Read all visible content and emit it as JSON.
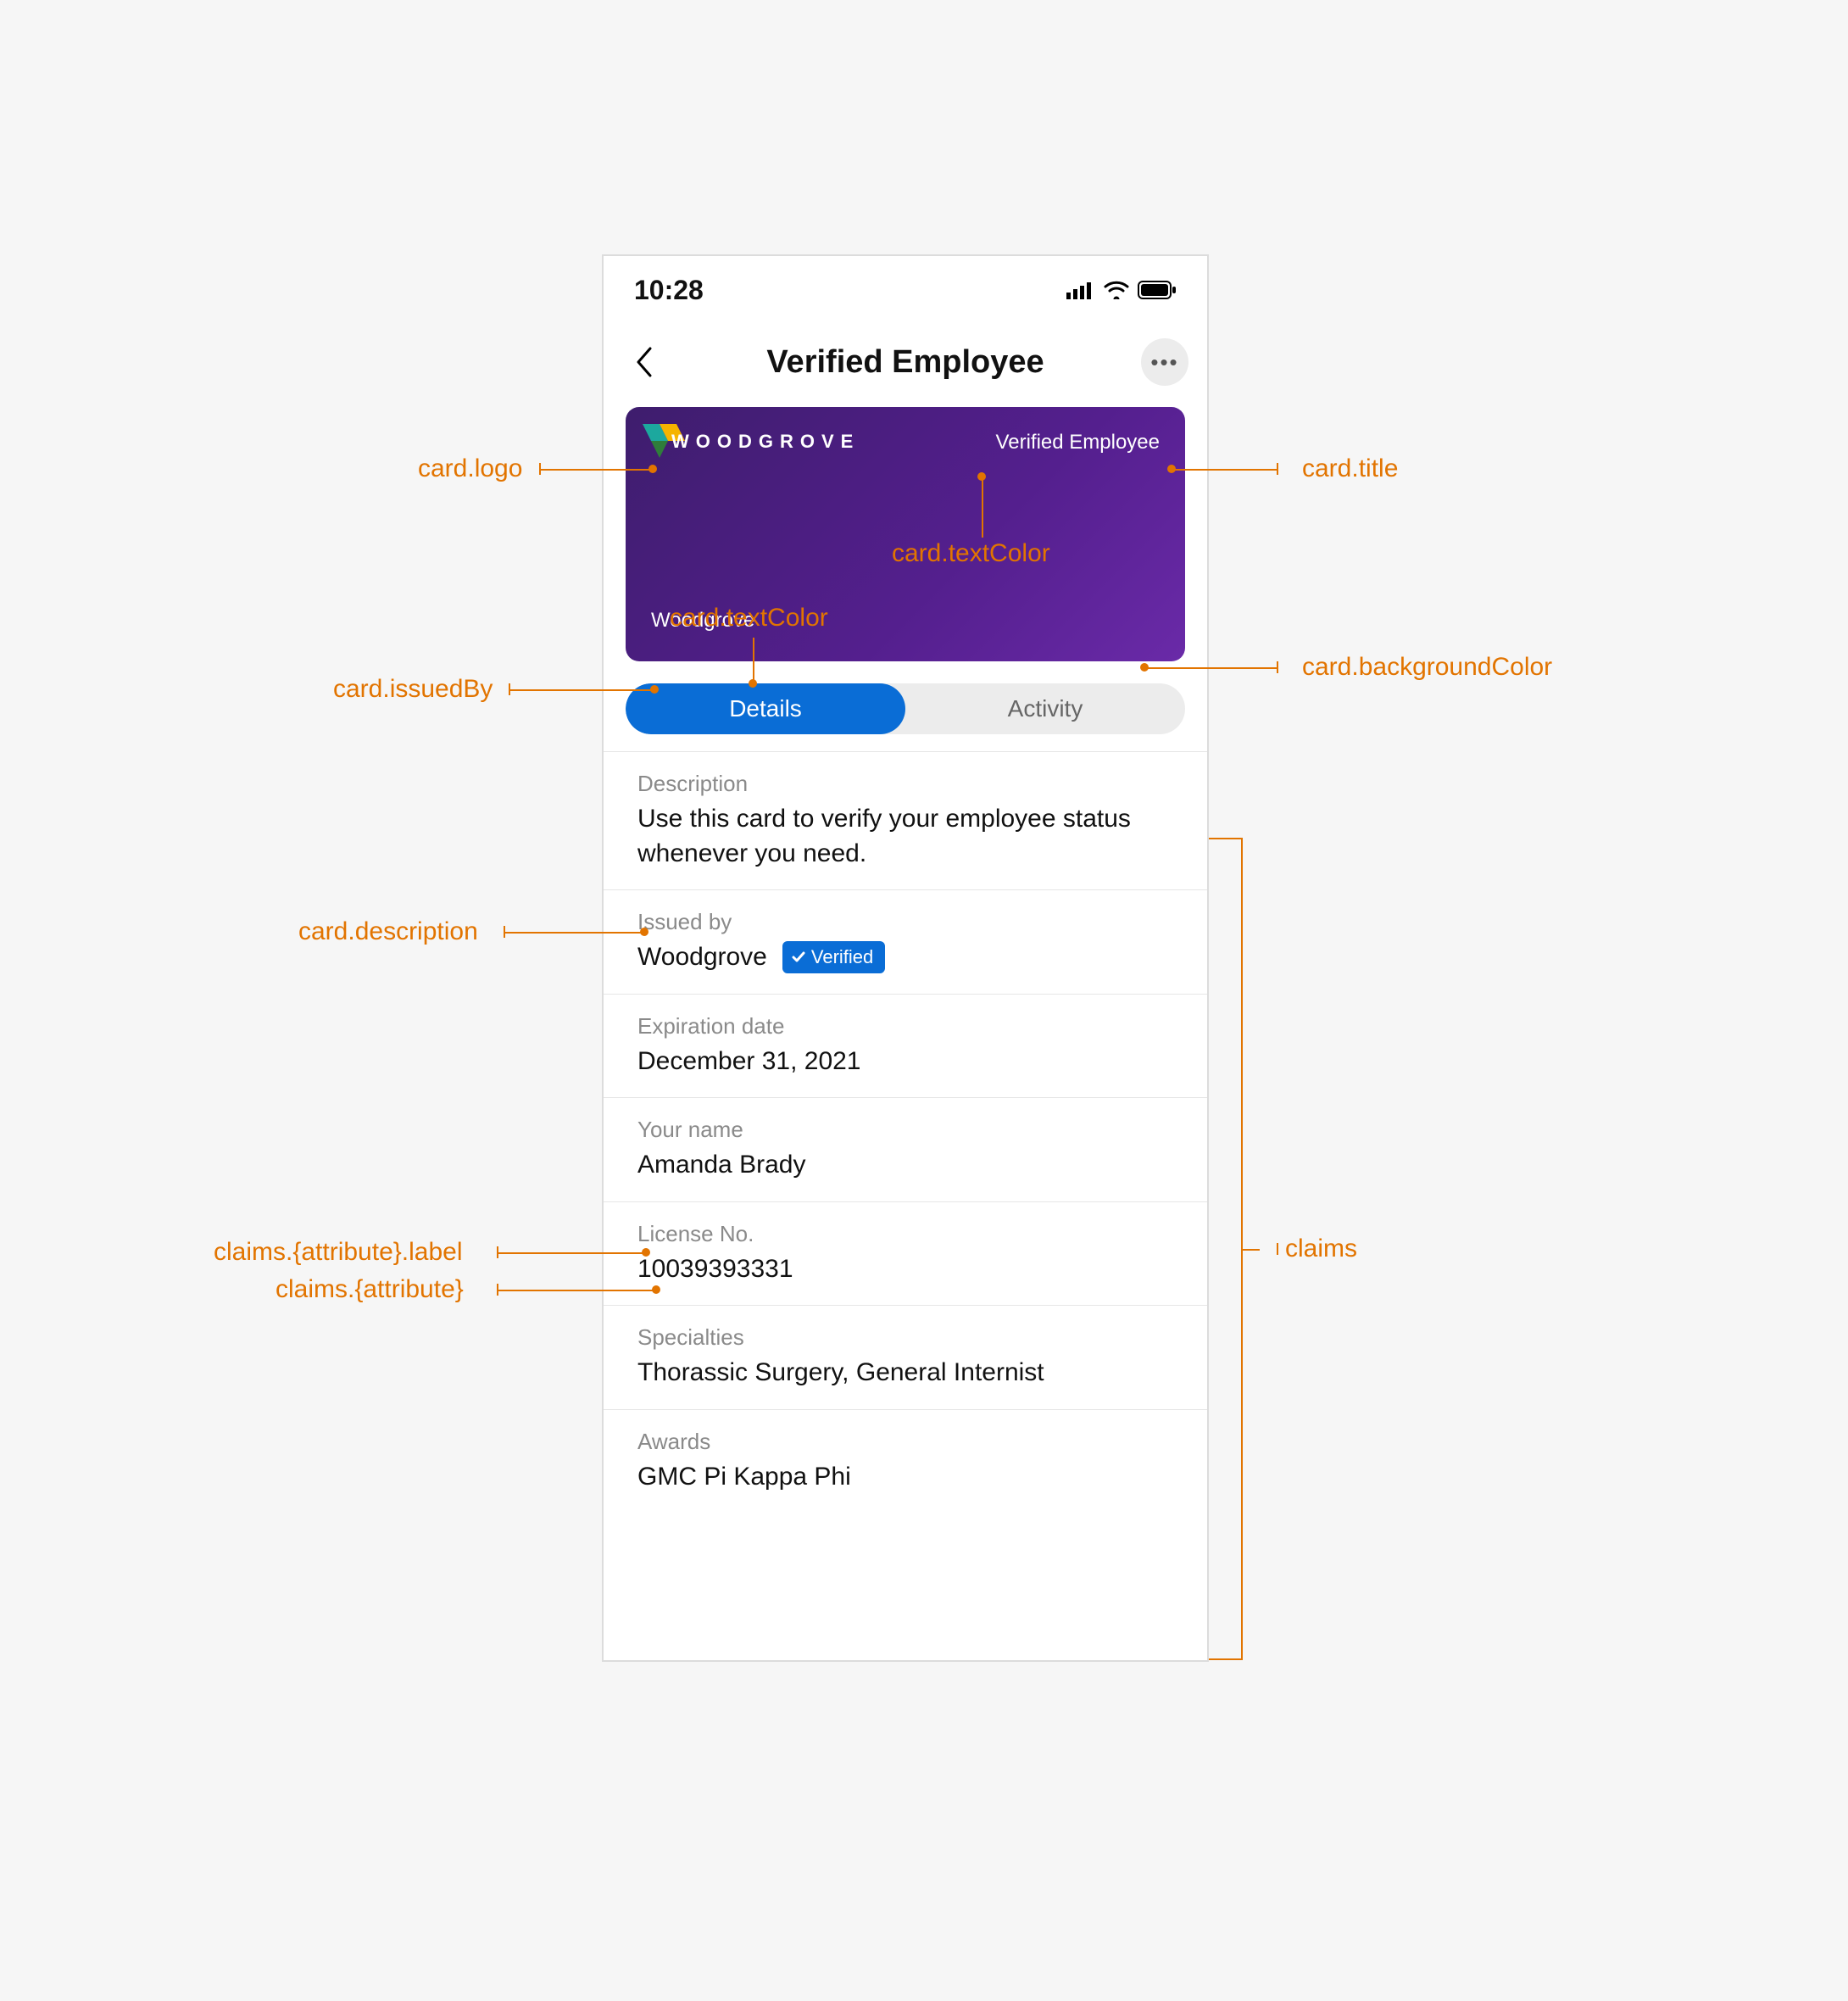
{
  "statusbar": {
    "time": "10:28"
  },
  "nav": {
    "title": "Verified Employee"
  },
  "card": {
    "brand": "WOODGROVE",
    "title": "Verified Employee",
    "issuedBy": "Woodgrove"
  },
  "tabs": {
    "details": "Details",
    "activity": "Activity"
  },
  "details": {
    "description_label": "Description",
    "description_value": "Use this card to verify your employee status whenever you need.",
    "issuedby_label": "Issued by",
    "issuedby_value": "Woodgrove",
    "verified_badge": "Verified",
    "expiration_label": "Expiration date",
    "expiration_value": "December 31, 2021",
    "name_label": "Your name",
    "name_value": "Amanda Brady",
    "license_label": "License No.",
    "license_value": "10039393331",
    "specialties_label": "Specialties",
    "specialties_value": "Thorassic Surgery, General Internist",
    "awards_label": "Awards",
    "awards_value": "GMC Pi Kappa Phi"
  },
  "annotations": {
    "card_logo": "card.logo",
    "card_title": "card.title",
    "card_textColor1": "card.textColor",
    "card_textColor2": "card.textColor",
    "card_issuedBy": "card.issuedBy",
    "card_backgroundColor": "card.backgroundColor",
    "card_description": "card.description",
    "claims": "claims",
    "claims_attr_label": "claims.{attribute}.label",
    "claims_attr": "claims.{attribute}"
  }
}
